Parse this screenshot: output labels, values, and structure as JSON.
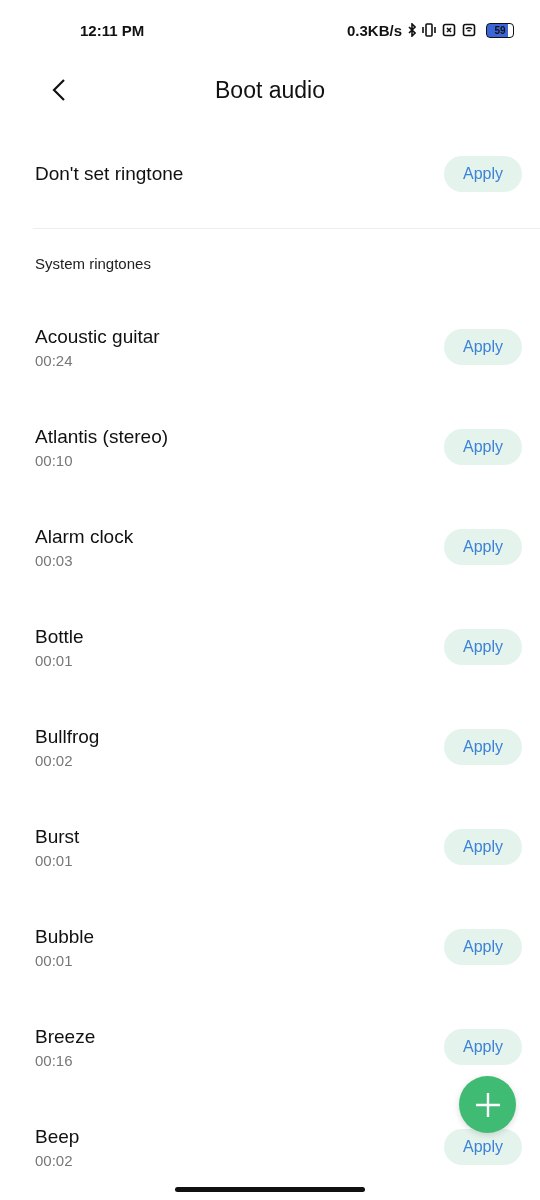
{
  "status_bar": {
    "time": "12:11 PM",
    "speed": "0.3KB/s",
    "battery": "59"
  },
  "header": {
    "title": "Boot audio"
  },
  "top_item": {
    "title": "Don't set ringtone",
    "action": "Apply"
  },
  "section": {
    "title": "System ringtones"
  },
  "ringtones": [
    {
      "title": "Acoustic guitar",
      "duration": "00:24",
      "action": "Apply"
    },
    {
      "title": "Atlantis (stereo)",
      "duration": "00:10",
      "action": "Apply"
    },
    {
      "title": "Alarm clock",
      "duration": "00:03",
      "action": "Apply"
    },
    {
      "title": "Bottle",
      "duration": "00:01",
      "action": "Apply"
    },
    {
      "title": "Bullfrog",
      "duration": "00:02",
      "action": "Apply"
    },
    {
      "title": "Burst",
      "duration": "00:01",
      "action": "Apply"
    },
    {
      "title": "Bubble",
      "duration": "00:01",
      "action": "Apply"
    },
    {
      "title": "Breeze",
      "duration": "00:16",
      "action": "Apply"
    },
    {
      "title": "Beep",
      "duration": "00:02",
      "action": "Apply"
    }
  ]
}
